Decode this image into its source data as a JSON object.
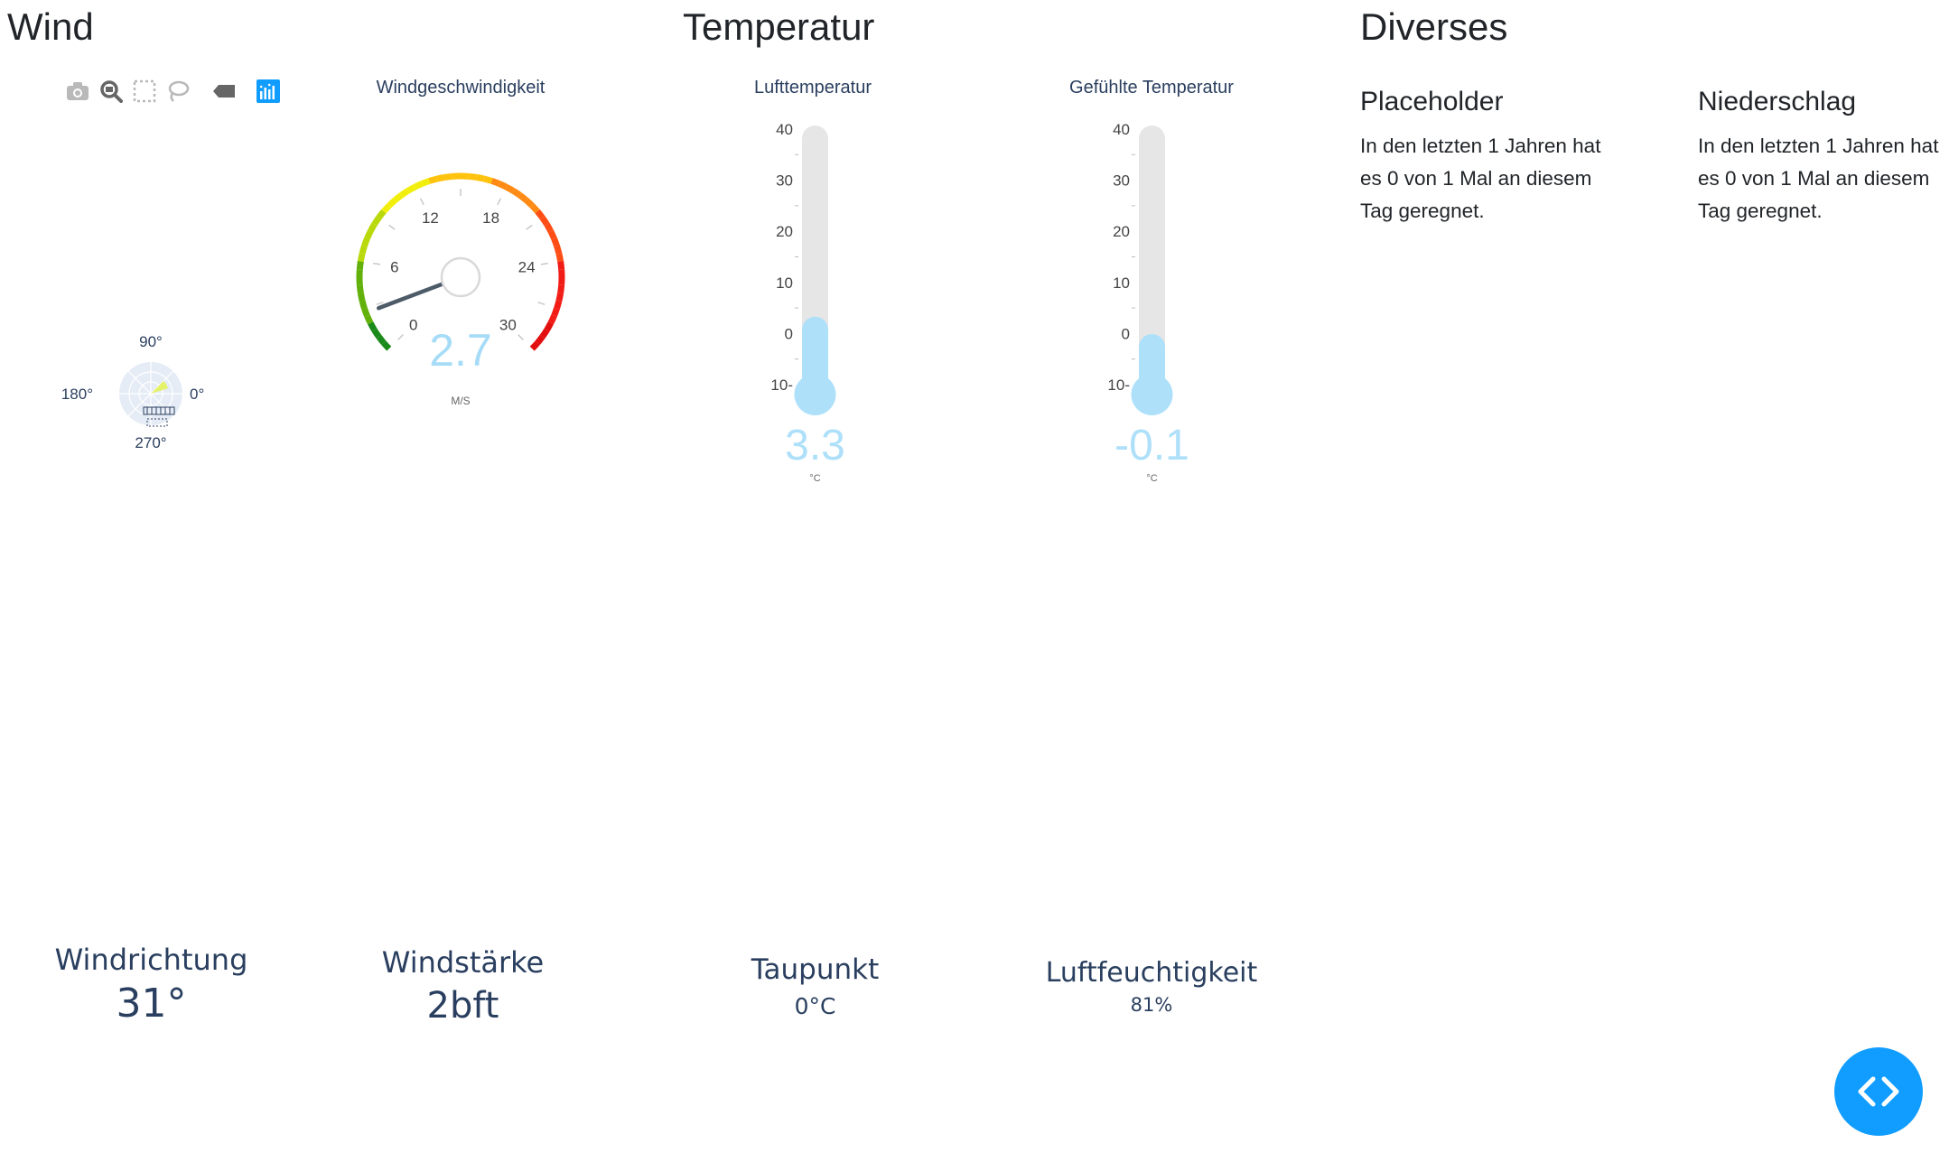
{
  "sections": {
    "wind": "Wind",
    "temperature": "Temperatur",
    "misc": "Diverses"
  },
  "toolbar": {
    "icons": [
      "camera-icon",
      "zoom-icon",
      "box-select-icon",
      "lasso-icon",
      "tag-icon",
      "plotly-logo-icon"
    ]
  },
  "gauge": {
    "title": "Windgeschwindigkeit",
    "value": 2.7,
    "value_text": "2.7",
    "unit": "M/S",
    "range": [
      0,
      30
    ],
    "ticks": [
      "0",
      "6",
      "12",
      "18",
      "24",
      "30"
    ]
  },
  "polar": {
    "labels": {
      "top": "90°",
      "left": "180°",
      "right": "0°",
      "bottom": "270°"
    },
    "direction_deg": 31
  },
  "thermo_air": {
    "title": "Lufttemperatur",
    "value": 3.3,
    "value_text": "3.3",
    "unit": "°C",
    "ticks": [
      "40",
      "30",
      "20",
      "10",
      "0",
      "10-"
    ],
    "range": [
      -10,
      40
    ]
  },
  "thermo_feels": {
    "title": "Gefühlte Temperatur",
    "value": -0.1,
    "value_text": "-0.1",
    "unit": "°C",
    "ticks": [
      "40",
      "30",
      "20",
      "10",
      "0",
      "10-"
    ],
    "range": [
      -10,
      40
    ]
  },
  "indicators": {
    "windrichtung": {
      "label": "Windrichtung",
      "value": "31°"
    },
    "windstaerke": {
      "label": "Windstärke",
      "value": "2bft"
    },
    "taupunkt": {
      "label": "Taupunkt",
      "value": "0°C"
    },
    "luftfeuchtigkeit": {
      "label": "Luftfeuchtigkeit",
      "value": "81%"
    }
  },
  "cards": [
    {
      "title": "Placeholder",
      "text": "In den letzten 1 Jahren hat es 0 von 1 Mal an diesem Tag geregnet."
    },
    {
      "title": "Niederschlag",
      "text": "In den letzten 1 Jahren hat es 0 von 1 Mal an diesem Tag geregnet."
    }
  ],
  "colors": {
    "accent": "#119dff",
    "thermo_fill": "#aee0fa",
    "thermo_track": "#e6e6e6",
    "text_dark": "#2a3f5f"
  }
}
